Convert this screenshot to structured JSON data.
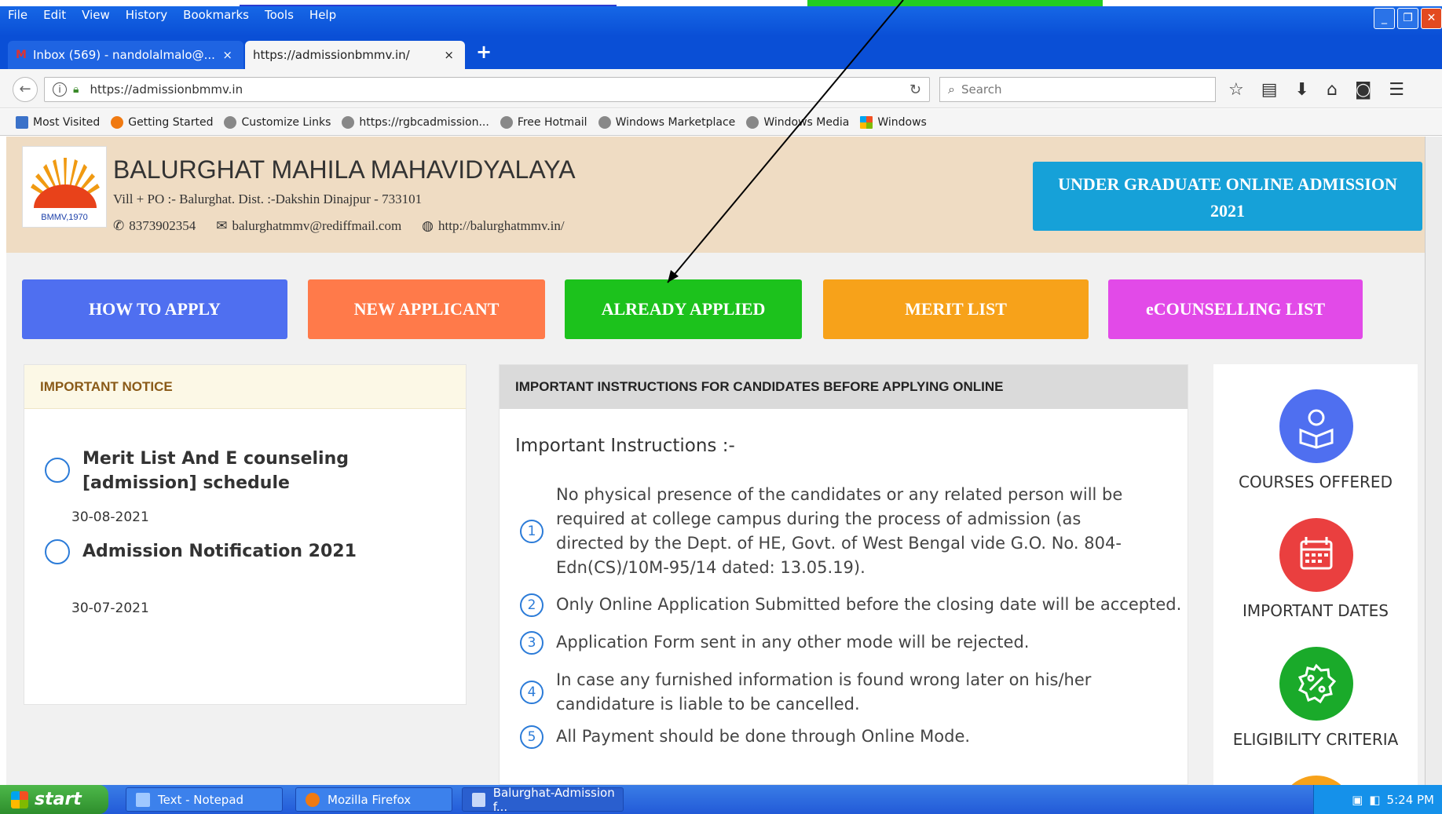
{
  "window": {
    "menu": [
      "File",
      "Edit",
      "View",
      "History",
      "Bookmarks",
      "Tools",
      "Help"
    ]
  },
  "tabs": [
    {
      "label": "Inbox (569) - nandolalmalo@...",
      "close": "×"
    },
    {
      "label": "https://admissionbmmv.in/",
      "close": "×"
    }
  ],
  "newtab_label": "+",
  "nav": {
    "url": "https://admissionbmmv.in",
    "search_placeholder": "Search"
  },
  "bookmarks": [
    "Most Visited",
    "Getting Started",
    "Customize Links",
    "https://rgbcadmission...",
    "Free Hotmail",
    "Windows Marketplace",
    "Windows Media",
    "Windows"
  ],
  "header": {
    "logo_text": "BMMV,1970",
    "college_name": "BALURGHAT MAHILA MAHAVIDYALAYA",
    "address": "Vill + PO :- Balurghat. Dist. :-Dakshin Dinajpur - 733101",
    "phone": "8373902354",
    "email": "balurghatmmv@rediffmail.com",
    "website": "http://balurghatmmv.in/",
    "banner_line1": "UNDER GRADUATE ONLINE ADMISSION",
    "banner_line2": "2021"
  },
  "buttons": {
    "how_to_apply": "HOW TO APPLY",
    "new_applicant": "NEW APPLICANT",
    "already_applied": "ALREADY APPLIED",
    "merit_list": "MERIT LIST",
    "ecounselling": "eCOUNSELLING LIST"
  },
  "notice": {
    "heading": "IMPORTANT NOTICE",
    "items": [
      {
        "title": "Merit List And E counseling [admission] schedule",
        "date": "30-08-2021"
      },
      {
        "title": "Admission Notification 2021",
        "date": "30-07-2021"
      }
    ]
  },
  "instructions": {
    "heading": "IMPORTANT INSTRUCTIONS FOR CANDIDATES BEFORE APPLYING ONLINE",
    "title": "Important Instructions :-",
    "items": [
      {
        "num": "1",
        "text": "No physical presence of the candidates or any related person will be required at college campus during the process of admission (as directed by the Dept. of HE, Govt. of West Bengal vide G.O. No. 804-Edn(CS)/10M-95/14 dated: 13.05.19)."
      },
      {
        "num": "2",
        "text": "Only Online Application Submitted before the closing date will be accepted."
      },
      {
        "num": "3",
        "text": "Application Form sent in any other mode will be rejected."
      },
      {
        "num": "4",
        "text": "In case any furnished information is found wrong later on his/her candidature is liable to be cancelled."
      },
      {
        "num": "5",
        "text": "All Payment should be done through Online Mode."
      }
    ]
  },
  "side_links": [
    {
      "label": "COURSES OFFERED",
      "icon": "reader-icon",
      "color": "#4f6ff0"
    },
    {
      "label": "IMPORTANT DATES",
      "icon": "calendar-icon",
      "color": "#ea3f3f"
    },
    {
      "label": "ELIGIBILITY CRITERIA",
      "icon": "percent-badge-icon",
      "color": "#1aaa2a"
    }
  ],
  "taskbar": {
    "start": "start",
    "tasks": [
      "Text - Notepad",
      "Mozilla Firefox",
      "Balurghat-Admission f..."
    ],
    "clock": "5:24 PM"
  }
}
